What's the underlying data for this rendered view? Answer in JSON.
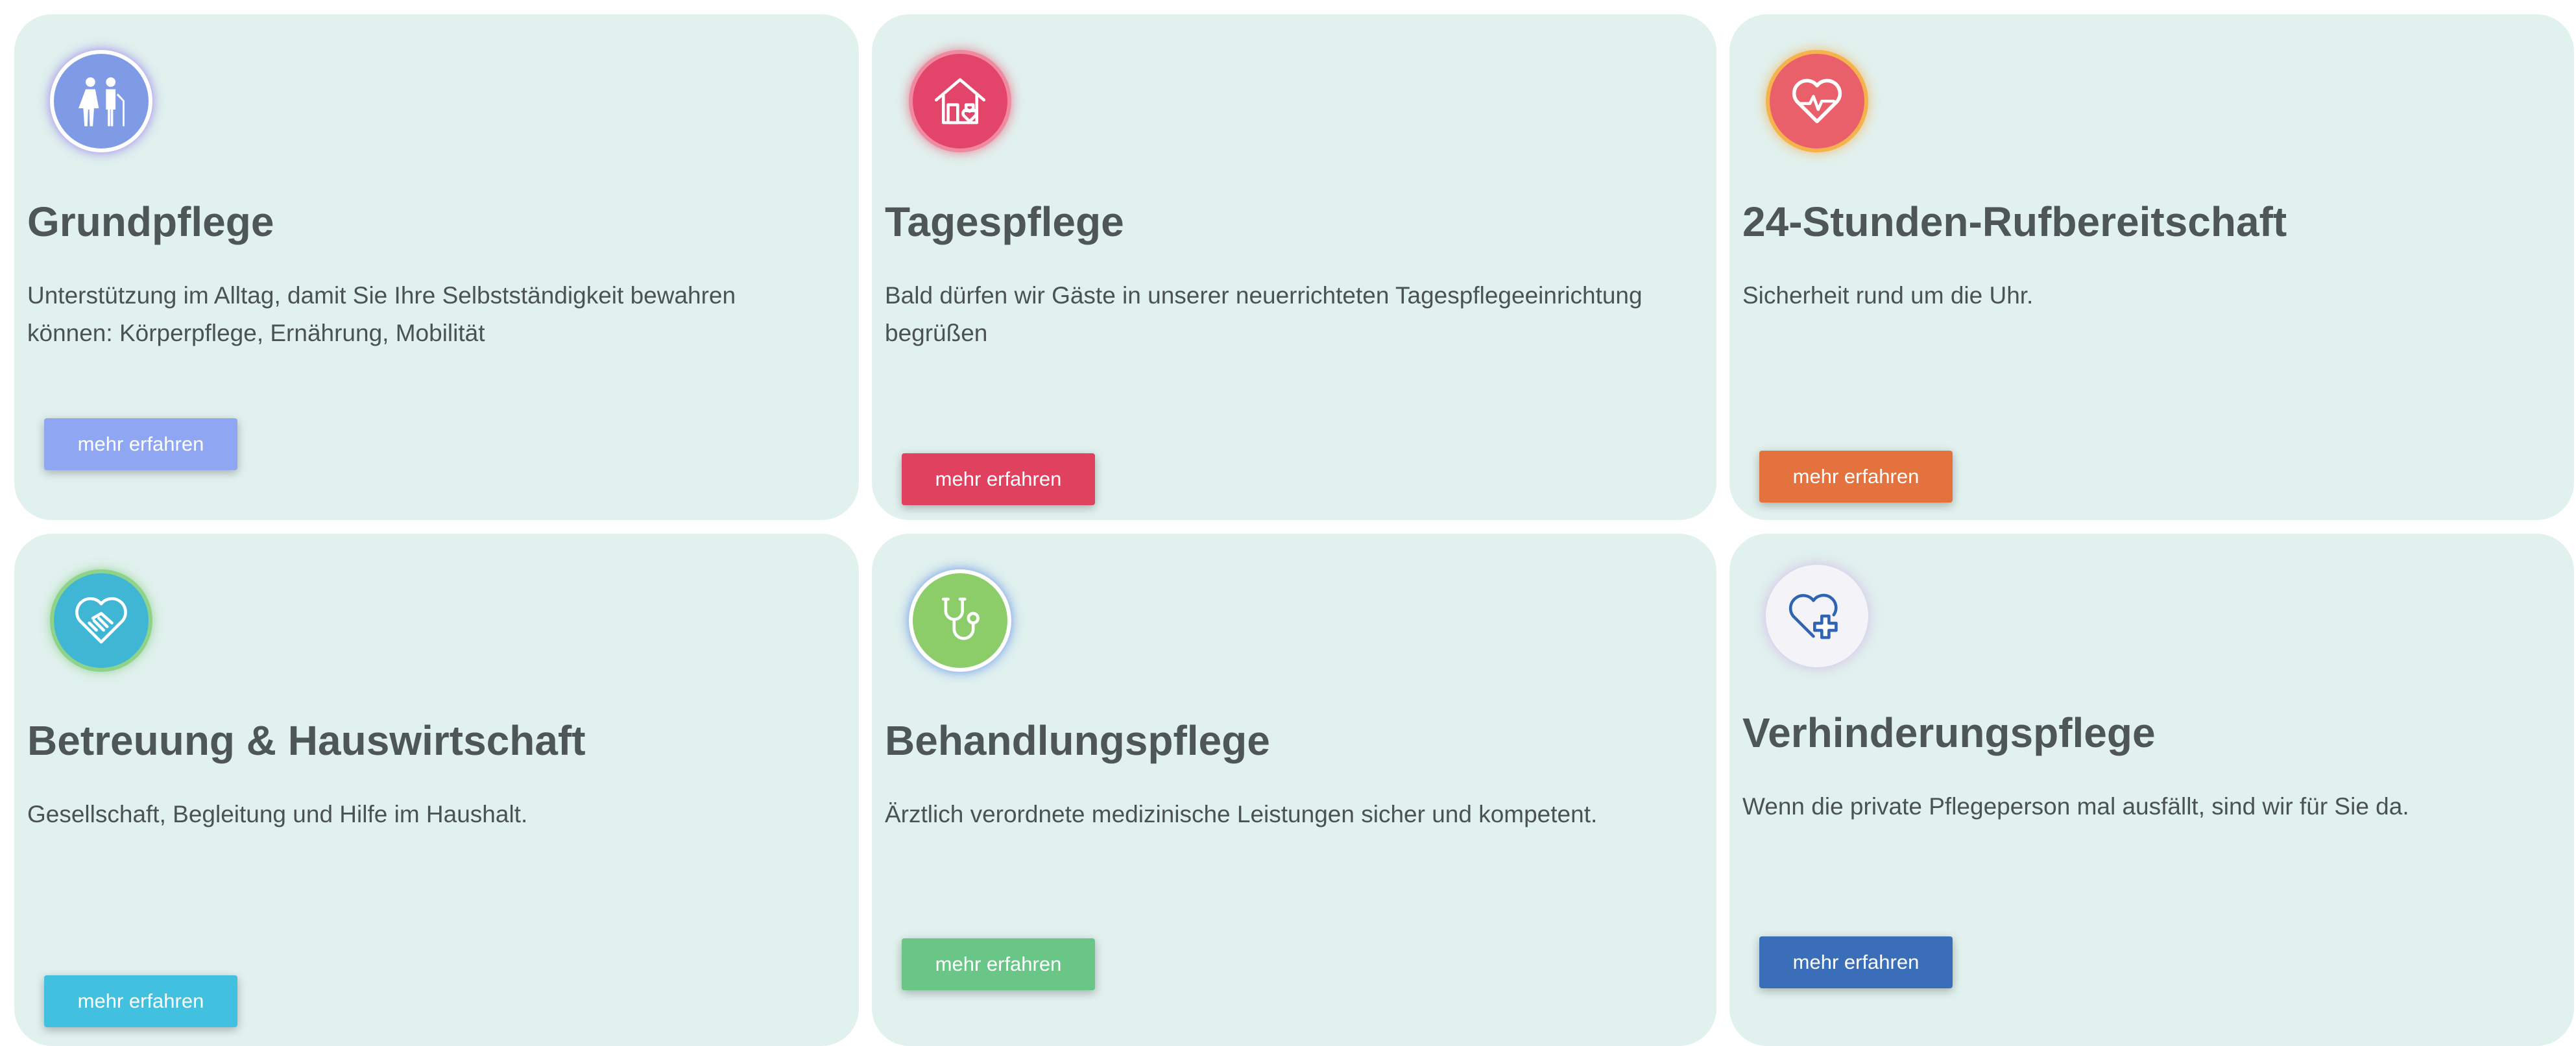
{
  "cards": [
    {
      "title": "Grundpflege",
      "description": "Unterstützung im Alltag, damit Sie Ihre Selbstständigkeit bewahren können: Körperpflege, Ernährung, Mobilität",
      "button_label": "mehr erfahren",
      "icon": "elderly-couple-icon",
      "icon_color": "#7f9be6",
      "button_color": "#8fa7f2"
    },
    {
      "title": "Tagespflege",
      "description": "Bald dürfen wir Gäste in unserer neuerrichteten Tagespflegeeinrichtung begrüßen",
      "button_label": "mehr erfahren",
      "icon": "house-heart-icon",
      "icon_color": "#e2446a",
      "button_color": "#e0415f"
    },
    {
      "title": "24-Stunden-Rufbereitschaft",
      "description": "Sicherheit rund um die Uhr.",
      "button_label": "mehr erfahren",
      "icon": "heartbeat-icon",
      "icon_color": "#e95f6a",
      "button_color": "#e3723f"
    },
    {
      "title": "Betreuung & Hauswirtschaft",
      "description": "Gesellschaft, Begleitung und Hilfe im Haushalt.",
      "button_label": "mehr erfahren",
      "icon": "heart-handshake-icon",
      "icon_color": "#3fb7d4",
      "button_color": "#41c0e0"
    },
    {
      "title": "Behandlungspflege",
      "description": "Ärztlich verordnete medizinische Leistungen sicher und kompetent.",
      "button_label": "mehr erfahren",
      "icon": "stethoscope-icon",
      "icon_color": "#8ccd6a",
      "button_color": "#69c687"
    },
    {
      "title": "Verhinderungspflege",
      "description": "Wenn die private Pflegeperson mal ausfällt, sind wir für Sie da.",
      "button_label": "mehr erfahren",
      "icon": "heart-medical-cross-icon",
      "icon_color": "#2f64b3",
      "button_color": "#3a6eb8"
    }
  ]
}
